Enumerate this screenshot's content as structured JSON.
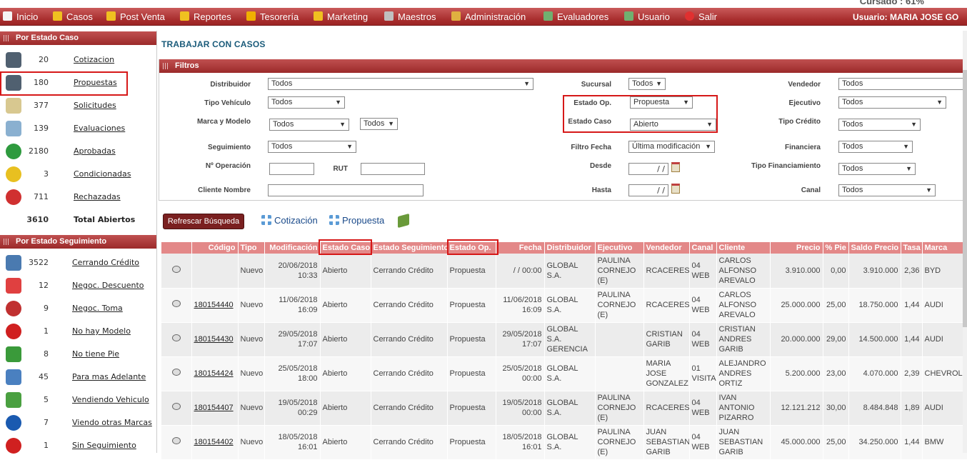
{
  "top_cut_text": "Cursado : 61%",
  "menu": {
    "items": [
      {
        "label": "Inicio",
        "icon": "home-icon",
        "color": "#f5f5f5"
      },
      {
        "label": "Casos",
        "icon": "folder-icon",
        "color": "#f0c020"
      },
      {
        "label": "Post Venta",
        "icon": "folder-icon",
        "color": "#f0c020"
      },
      {
        "label": "Reportes",
        "icon": "folder-icon",
        "color": "#f0c020"
      },
      {
        "label": "Tesorería",
        "icon": "coin-icon",
        "color": "#f0b000"
      },
      {
        "label": "Marketing",
        "icon": "screen-icon",
        "color": "#f0c020"
      },
      {
        "label": "Maestros",
        "icon": "database-icon",
        "color": "#c0c0c0"
      },
      {
        "label": "Administración",
        "icon": "key-icon",
        "color": "#e0b040"
      },
      {
        "label": "Evaluadores",
        "icon": "users-icon",
        "color": "#70b070"
      },
      {
        "label": "Usuario",
        "icon": "user-icon",
        "color": "#70b070"
      },
      {
        "label": "Salir",
        "icon": "exit-icon",
        "color": "#e03030"
      }
    ],
    "user_label": "Usuario:",
    "user_name": "MARIA JOSE GO"
  },
  "sidebar": {
    "estado_caso": {
      "title": "Por Estado Caso",
      "items": [
        {
          "count": "20",
          "label": "Cotizacion",
          "icon": "calculator-icon",
          "color": "#506070"
        },
        {
          "count": "180",
          "label": "Propuestas",
          "icon": "calculator-icon",
          "color": "#506070"
        },
        {
          "count": "377",
          "label": "Solicitudes",
          "icon": "notepad-icon",
          "color": "#d8c890"
        },
        {
          "count": "139",
          "label": "Evaluaciones",
          "icon": "search-doc-icon",
          "color": "#8ab0d0"
        },
        {
          "count": "2180",
          "label": "Aprobadas",
          "icon": "shield-check-icon",
          "color": "#2e9a3e"
        },
        {
          "count": "3",
          "label": "Condicionadas",
          "icon": "shield-warning-icon",
          "color": "#e8c020"
        },
        {
          "count": "711",
          "label": "Rechazadas",
          "icon": "shield-x-icon",
          "color": "#d03030"
        }
      ],
      "total_count": "3610",
      "total_label": "Total Abiertos"
    },
    "estado_seguimiento": {
      "title": "Por Estado Seguimiento",
      "items": [
        {
          "count": "3522",
          "label": "Cerrando Crédito",
          "icon": "signing-icon",
          "color": "#4a7ab0"
        },
        {
          "count": "12",
          "label": "Negoc. Descuento",
          "icon": "discount-tag-icon",
          "color": "#e04040"
        },
        {
          "count": "9",
          "label": "Negoc. Toma",
          "icon": "tire-icon",
          "color": "#c03030"
        },
        {
          "count": "1",
          "label": "No hay Modelo",
          "icon": "x-circle-icon",
          "color": "#d02020"
        },
        {
          "count": "8",
          "label": "No tiene Pie",
          "icon": "money-stack-icon",
          "color": "#3a9a3a"
        },
        {
          "count": "45",
          "label": "Para mas Adelante",
          "icon": "calendar-icon",
          "color": "#4a80c0"
        },
        {
          "count": "5",
          "label": "Vendiendo Vehiculo",
          "icon": "money-icon",
          "color": "#4aa040"
        },
        {
          "count": "7",
          "label": "Viendo otras Marcas",
          "icon": "question-icon",
          "color": "#1a5ab0"
        },
        {
          "count": "1",
          "label": "Sin Seguimiento",
          "icon": "no-entry-icon",
          "color": "#d02020"
        }
      ]
    }
  },
  "page_title": "TRABAJAR CON CASOS",
  "filters": {
    "title": "Filtros",
    "distribuidor": {
      "label": "Distribuidor",
      "value": "Todos"
    },
    "tipo_vehiculo": {
      "label": "Tipo Vehículo",
      "value": "Todos"
    },
    "marca_modelo": {
      "label": "Marca y Modelo",
      "value": "Todos",
      "value2": "Todos"
    },
    "seguimiento": {
      "label": "Seguimiento",
      "value": "Todos"
    },
    "num_operacion": {
      "label": "Nº Operación",
      "value": ""
    },
    "rut": {
      "label": "RUT",
      "value": ""
    },
    "cliente_nombre": {
      "label": "Cliente Nombre",
      "value": ""
    },
    "sucursal": {
      "label": "Sucursal",
      "value": "Todos"
    },
    "estado_op": {
      "label": "Estado Op.",
      "value": "Propuesta"
    },
    "estado_caso": {
      "label": "Estado Caso",
      "value": "Abierto"
    },
    "filtro_fecha": {
      "label": "Filtro Fecha",
      "value": "Última modificación"
    },
    "desde": {
      "label": "Desde",
      "value": "/ /"
    },
    "hasta": {
      "label": "Hasta",
      "value": "/ /"
    },
    "vendedor": {
      "label": "Vendedor",
      "value": "Todos"
    },
    "ejecutivo": {
      "label": "Ejecutivo",
      "value": "Todos"
    },
    "tipo_credito": {
      "label": "Tipo Crédito",
      "value": "Todos"
    },
    "financiera": {
      "label": "Financiera",
      "value": "Todos"
    },
    "tipo_financiamiento": {
      "label": "Tipo Financiamiento",
      "value": "Todos"
    },
    "canal": {
      "label": "Canal",
      "value": "Todos"
    }
  },
  "actions": {
    "refresh_label": "Refrescar Búsqueda",
    "add_cotizacion_label": "Cotización",
    "add_propuesta_label": "Propuesta"
  },
  "table": {
    "columns": [
      "",
      "Código",
      "Tipo",
      "Modificación",
      "Estado Caso",
      "Estado Seguimiento",
      "Estado Op.",
      "Fecha",
      "Distribuidor",
      "Ejecutivo",
      "Vendedor",
      "Canal",
      "Cliente",
      "Precio",
      "% Pie",
      "Saldo Precio",
      "Tasa",
      "Marca"
    ],
    "rows": [
      [
        "",
        "",
        "Nuevo",
        "20/06/2018 10:33",
        "Abierto",
        "Cerrando Crédito",
        "Propuesta",
        "/ / 00:00",
        "GLOBAL S.A.",
        "PAULINA CORNEJO (E)",
        "RCACERES",
        "04 WEB",
        "CARLOS ALFONSO AREVALO",
        "3.910.000",
        "0,00",
        "3.910.000",
        "2,36",
        "BYD"
      ],
      [
        "",
        "180154440",
        "Nuevo",
        "11/06/2018 16:09",
        "Abierto",
        "Cerrando Crédito",
        "Propuesta",
        "11/06/2018 16:09",
        "GLOBAL S.A.",
        "PAULINA CORNEJO (E)",
        "RCACERES",
        "04 WEB",
        "CARLOS ALFONSO AREVALO",
        "25.000.000",
        "25,00",
        "18.750.000",
        "1,44",
        "AUDI"
      ],
      [
        "",
        "180154430",
        "Nuevo",
        "29/05/2018 17:07",
        "Abierto",
        "Cerrando Crédito",
        "Propuesta",
        "29/05/2018 17:07",
        "GLOBAL S.A. GERENCIA",
        "",
        "CRISTIAN GARIB",
        "04 WEB",
        "CRISTIAN ANDRES GARIB",
        "20.000.000",
        "29,00",
        "14.500.000",
        "1,44",
        "AUDI"
      ],
      [
        "",
        "180154424",
        "Nuevo",
        "25/05/2018 18:00",
        "Abierto",
        "Cerrando Crédito",
        "Propuesta",
        "25/05/2018 00:00",
        "GLOBAL S.A.",
        "",
        "MARIA JOSE GONZALEZ",
        "01 VISITA",
        "ALEJANDRO ANDRES ORTIZ",
        "5.200.000",
        "23,00",
        "4.070.000",
        "2,39",
        "CHEVROLET"
      ],
      [
        "",
        "180154407",
        "Nuevo",
        "19/05/2018 00:29",
        "Abierto",
        "Cerrando Crédito",
        "Propuesta",
        "19/05/2018 00:00",
        "GLOBAL S.A.",
        "PAULINA CORNEJO (E)",
        "RCACERES",
        "04 WEB",
        "IVAN ANTONIO PIZARRO",
        "12.121.212",
        "30,00",
        "8.484.848",
        "1,89",
        "AUDI"
      ],
      [
        "",
        "180154402",
        "Nuevo",
        "18/05/2018 16:01",
        "Abierto",
        "Cerrando Crédito",
        "Propuesta",
        "18/05/2018 16:01",
        "GLOBAL S.A.",
        "PAULINA CORNEJO (E)",
        "JUAN SEBASTIAN GARIB",
        "04 WEB",
        "JUAN SEBASTIAN GARIB",
        "45.000.000",
        "25,00",
        "34.250.000",
        "1,44",
        "BMW"
      ]
    ]
  }
}
